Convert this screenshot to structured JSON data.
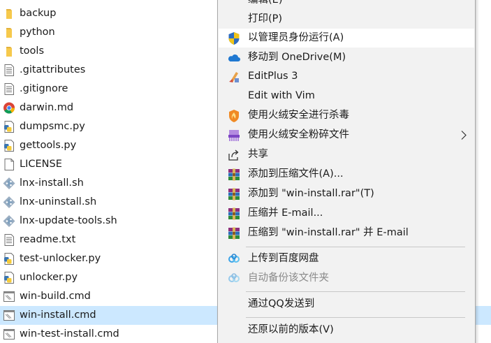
{
  "files": [
    {
      "name": "backup",
      "icon": "folder-icon",
      "selected": false
    },
    {
      "name": "python",
      "icon": "folder-icon",
      "selected": false
    },
    {
      "name": "tools",
      "icon": "folder-icon",
      "selected": false
    },
    {
      "name": ".gitattributes",
      "icon": "text-file-icon",
      "selected": false
    },
    {
      "name": ".gitignore",
      "icon": "text-file-icon",
      "selected": false
    },
    {
      "name": "darwin.md",
      "icon": "chrome-icon",
      "selected": false
    },
    {
      "name": "dumpsmc.py",
      "icon": "python-file-icon",
      "selected": false
    },
    {
      "name": "gettools.py",
      "icon": "python-file-icon",
      "selected": false
    },
    {
      "name": "LICENSE",
      "icon": "blank-file-icon",
      "selected": false
    },
    {
      "name": "lnx-install.sh",
      "icon": "git-file-icon",
      "selected": false
    },
    {
      "name": "lnx-uninstall.sh",
      "icon": "git-file-icon",
      "selected": false
    },
    {
      "name": "lnx-update-tools.sh",
      "icon": "git-file-icon",
      "selected": false
    },
    {
      "name": "readme.txt",
      "icon": "text-file-icon",
      "selected": false
    },
    {
      "name": "test-unlocker.py",
      "icon": "python-file-icon",
      "selected": false
    },
    {
      "name": "unlocker.py",
      "icon": "python-file-icon",
      "selected": false
    },
    {
      "name": "win-build.cmd",
      "icon": "cmd-file-icon",
      "selected": false
    },
    {
      "name": "win-install.cmd",
      "icon": "cmd-file-icon",
      "selected": true
    },
    {
      "name": "win-test-install.cmd",
      "icon": "cmd-file-icon",
      "selected": false
    }
  ],
  "context_menu": {
    "items": [
      {
        "label": "编辑(E)",
        "icon": "",
        "disabled": false,
        "hover": false,
        "submenu": false
      },
      {
        "label": "打印(P)",
        "icon": "",
        "disabled": false,
        "hover": false,
        "submenu": false
      },
      {
        "label": "以管理员身份运行(A)",
        "icon": "uac-shield-icon",
        "disabled": false,
        "hover": true,
        "submenu": false
      },
      {
        "label": "移动到 OneDrive(M)",
        "icon": "onedrive-cloud-icon",
        "disabled": false,
        "hover": false,
        "submenu": false
      },
      {
        "label": "EditPlus 3",
        "icon": "editplus-icon",
        "disabled": false,
        "hover": false,
        "submenu": false
      },
      {
        "label": "Edit with Vim",
        "icon": "",
        "disabled": false,
        "hover": false,
        "submenu": false
      },
      {
        "label": "使用火绒安全进行杀毒",
        "icon": "huorong-shield-icon",
        "disabled": false,
        "hover": false,
        "submenu": false
      },
      {
        "label": "使用火绒安全粉碎文件",
        "icon": "shredder-icon",
        "disabled": false,
        "hover": false,
        "submenu": true
      },
      {
        "label": "共享",
        "icon": "share-icon",
        "disabled": false,
        "hover": false,
        "submenu": false
      },
      {
        "label": "添加到压缩文件(A)...",
        "icon": "winrar-icon",
        "disabled": false,
        "hover": false,
        "submenu": false
      },
      {
        "label": "添加到 \"win-install.rar\"(T)",
        "icon": "winrar-icon",
        "disabled": false,
        "hover": false,
        "submenu": false
      },
      {
        "label": "压缩并 E-mail...",
        "icon": "winrar-icon",
        "disabled": false,
        "hover": false,
        "submenu": false
      },
      {
        "label": "压缩到 \"win-install.rar\" 并 E-mail",
        "icon": "winrar-icon",
        "disabled": false,
        "hover": false,
        "submenu": false
      },
      {
        "label": "上传到百度网盘",
        "icon": "baidu-netdisk-icon",
        "disabled": false,
        "hover": false,
        "submenu": false
      },
      {
        "label": "自动备份该文件夹",
        "icon": "baidu-netdisk-icon",
        "disabled": true,
        "hover": false,
        "submenu": false
      },
      {
        "label": "通过QQ发送到",
        "icon": "",
        "disabled": false,
        "hover": false,
        "submenu": false
      },
      {
        "label": "还原以前的版本(V)",
        "icon": "",
        "disabled": false,
        "hover": false,
        "submenu": false
      }
    ]
  },
  "colors": {
    "selection": "#cce8ff",
    "menu_background": "#f2f2f2",
    "menu_hover": "#ffffff",
    "disabled_text": "#8a8a8a"
  }
}
